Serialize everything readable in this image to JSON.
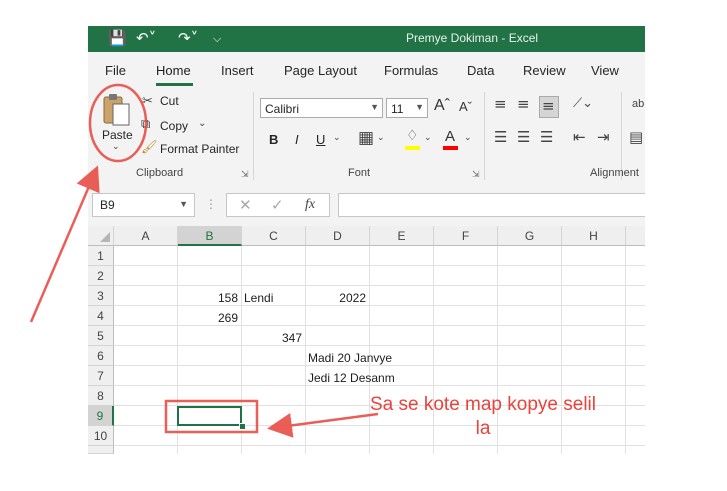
{
  "window": {
    "title": "Premye Dokiman  -  Excel",
    "title_bar_color": "#217346"
  },
  "quick_access": {
    "icons": [
      "save-icon",
      "undo-icon",
      "redo-icon",
      "customize-icon"
    ]
  },
  "menu": {
    "tabs": [
      "File",
      "Home",
      "Insert",
      "Page Layout",
      "Formulas",
      "Data",
      "Review",
      "View"
    ],
    "active": "Home"
  },
  "ribbon": {
    "clipboard": {
      "paste_label": "Paste",
      "cut_label": "Cut",
      "copy_label": "Copy",
      "format_painter_label": "Format Painter",
      "group_label": "Clipboard"
    },
    "font": {
      "font_name": "Calibri",
      "font_size": "11",
      "bold_label": "B",
      "italic_label": "I",
      "underline_label": "U",
      "group_label": "Font",
      "highlight_color": "#ffff00",
      "font_color": "#ff0000"
    },
    "alignment": {
      "group_label": "Alignment",
      "wrap_label": "ab"
    }
  },
  "formula_bar": {
    "name_box": "B9",
    "fx_label": "fx",
    "formula": ""
  },
  "sheet": {
    "columns": [
      "A",
      "B",
      "C",
      "D",
      "E",
      "F",
      "G",
      "H"
    ],
    "rows": [
      "1",
      "2",
      "3",
      "4",
      "5",
      "6",
      "7",
      "8",
      "9",
      "10"
    ],
    "selected_cell": "B9",
    "cells": {
      "B3": "158",
      "C3": "Lendi",
      "D3": "2022",
      "B4": "269",
      "C5": "347",
      "D6": "Madi 20 Janvye",
      "D7": "Jedi 12 Desanm"
    }
  },
  "annotation": {
    "callout_text": "Sa se kote map kopye selil la",
    "color": "#e8433c"
  }
}
